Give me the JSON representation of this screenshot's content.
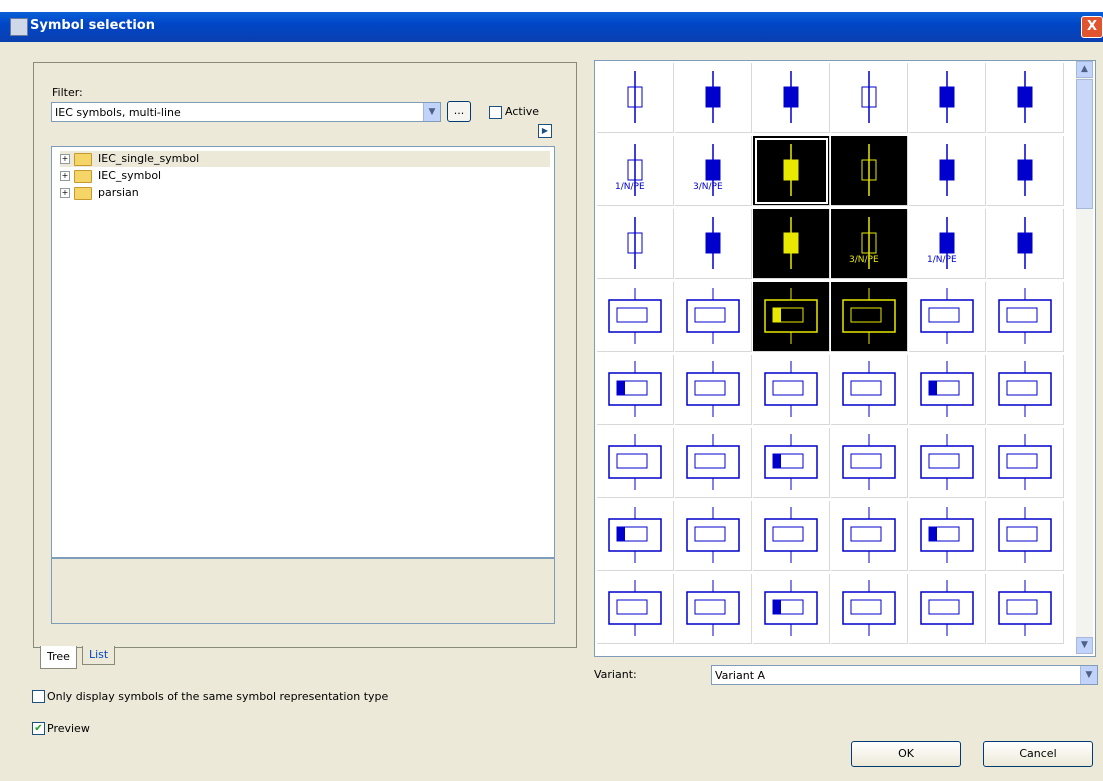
{
  "window": {
    "title": "Symbol selection",
    "close_glyph": "X"
  },
  "filter": {
    "label": "Filter:",
    "value": "IEC symbols, multi-line",
    "browse_label": "...",
    "active_label": "Active",
    "active_checked": false
  },
  "tree": {
    "items": [
      {
        "label": "IEC_single_symbol",
        "selected": true
      },
      {
        "label": "IEC_symbol",
        "selected": false
      },
      {
        "label": "parsian",
        "selected": false
      }
    ]
  },
  "tabs": {
    "tree": "Tree",
    "list": "List",
    "active": "tree"
  },
  "options": {
    "same_type_label": "Only display symbols of the same symbol representation type",
    "same_type_checked": false,
    "preview_label": "Preview",
    "preview_checked": true
  },
  "symbol_grid": {
    "columns": 6,
    "rows": 8,
    "dark_cells": [
      8,
      9,
      14,
      15,
      20,
      21
    ],
    "selected_cell": 8,
    "symbol_color": "#0000cc",
    "dark_symbol_color": "#e8e800",
    "labels": {
      "6": "1/N/PE",
      "7": "3/N/PE",
      "15": "3/N/PE",
      "16": "1/N/PE"
    }
  },
  "variant": {
    "label": "Variant:",
    "value": "Variant A"
  },
  "buttons": {
    "ok": "OK",
    "cancel": "Cancel"
  },
  "colors": {
    "titlebar": "#0046c6",
    "dialog_bg": "#ece9d8",
    "close_button": "#e0542e"
  }
}
